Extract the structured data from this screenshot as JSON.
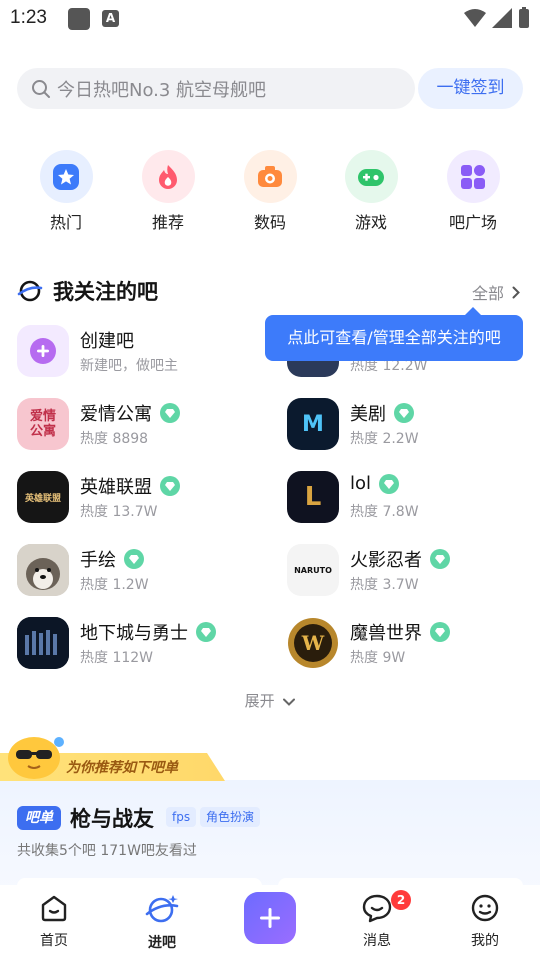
{
  "status_bar": {
    "time": "1:23"
  },
  "search": {
    "placeholder": "今日热吧No.3 航空母舰吧",
    "signin_label": "一键签到"
  },
  "quick_nav": [
    {
      "label": "热门",
      "icon": "star-icon",
      "color": "#3d7bfa"
    },
    {
      "label": "推荐",
      "icon": "flame-icon",
      "color": "#ff5a6e"
    },
    {
      "label": "数码",
      "icon": "camera-icon",
      "color": "#ff8a3d"
    },
    {
      "label": "游戏",
      "icon": "gamepad-icon",
      "color": "#2fc46a"
    },
    {
      "label": "吧广场",
      "icon": "grid-icon",
      "color": "#8a5cf6"
    }
  ],
  "followed": {
    "title": "我关注的吧",
    "all_label": "全部",
    "tooltip": "点此可查看/管理全部关注的吧",
    "create": {
      "name": "创建吧",
      "sub": "新建吧，做吧主"
    },
    "partial_right_sub": "热度 12.2W",
    "forums": [
      {
        "name": "爱情公寓",
        "heat": "热度 8898",
        "avatar_text": "爱情\n公寓"
      },
      {
        "name": "美剧",
        "heat": "热度 2.2W",
        "avatar_text": "M"
      },
      {
        "name": "英雄联盟",
        "heat": "热度 13.7W",
        "avatar_text": "英雄联盟"
      },
      {
        "name": "lol",
        "heat": "热度 7.8W",
        "avatar_text": "L"
      },
      {
        "name": "手绘",
        "heat": "热度 1.2W",
        "avatar_text": ""
      },
      {
        "name": "火影忍者",
        "heat": "热度 3.7W",
        "avatar_text": "NARUTO"
      },
      {
        "name": "地下城与勇士",
        "heat": "热度 112W",
        "avatar_text": ""
      },
      {
        "name": "魔兽世界",
        "heat": "热度 9W",
        "avatar_text": "W"
      }
    ],
    "expand_label": "展开"
  },
  "recommend": {
    "banner_title": "为你推荐如下吧单",
    "badge": "吧单",
    "list_name": "枪与战友",
    "tags": [
      "fps",
      "角色扮演"
    ],
    "desc": "共收集5个吧 171W吧友看过"
  },
  "bottom_nav": {
    "home": "首页",
    "enter": "进吧",
    "messages": "消息",
    "messages_badge": "2",
    "mine": "我的"
  }
}
